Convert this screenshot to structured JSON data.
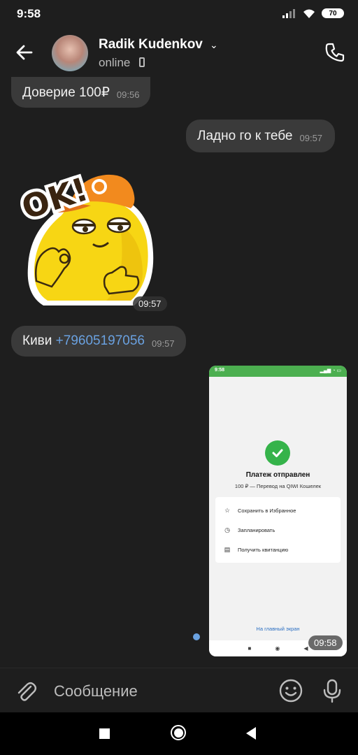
{
  "status_bar": {
    "time": "9:58",
    "battery": "70"
  },
  "header": {
    "contact_name": "Radik Kudenkov",
    "contact_status": "online"
  },
  "messages": [
    {
      "text": "Доверие 100₽",
      "time": "09:56",
      "direction": "incoming"
    },
    {
      "text": "Ладно го к тебе",
      "time": "09:57",
      "direction": "outgoing"
    },
    {
      "type": "sticker",
      "sticker_text": "OK!",
      "time": "09:57",
      "direction": "incoming"
    },
    {
      "text": "Киви",
      "link": "+79605197056",
      "time": "09:57",
      "direction": "incoming"
    },
    {
      "type": "image",
      "time": "09:58",
      "direction": "outgoing"
    }
  ],
  "screenshot": {
    "status_time": "9:58",
    "title": "Платеж отправлен",
    "subtitle": "100 ₽ — Перевод на QIWI Кошелек",
    "actions": [
      "Сохранить в Избранное",
      "Запланировать",
      "Получить квитанцию"
    ],
    "home_link": "На главный экран"
  },
  "input": {
    "placeholder": "Сообщение"
  },
  "colors": {
    "background": "#1e1e1e",
    "bubble": "#3a3a3a",
    "link": "#6aa1e0",
    "success": "#35b34a"
  }
}
